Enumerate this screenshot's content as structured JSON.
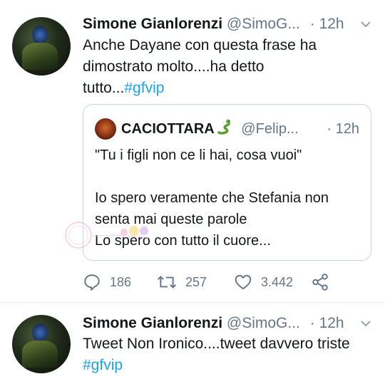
{
  "tweets": [
    {
      "author_name": "Simone Gianlorenzi",
      "author_handle": "@SimoG...",
      "time": "· 12h",
      "text_lines": [
        "Anche Dayane con questa frase ha",
        "dimostrato molto....ha detto",
        "tutto..."
      ],
      "hashtag": "#gfvip",
      "quote": {
        "author_name": "CACIOTTARA",
        "author_emoji": "snake-emoji",
        "author_handle": "@Felip...",
        "time": "· 12h",
        "line1": "\"Tu i figli non ce li hai, cosa vuoi\"",
        "line2": "Io spero veramente che Stefania non",
        "line3": "senta mai queste parole",
        "line4": "Lo spero con tutto il cuore..."
      },
      "stats": {
        "replies": "186",
        "retweets": "257",
        "likes": "3.442"
      }
    },
    {
      "author_name": "Simone Gianlorenzi",
      "author_handle": "@SimoG...",
      "time": "· 12h",
      "text_line1": "Tweet Non Ironico....tweet davvero triste",
      "hashtag": "#gfvip"
    }
  ],
  "colors": {
    "link": "#1da1f2",
    "muted": "#657786",
    "border": "#ccd6dd",
    "text": "#14171a"
  }
}
